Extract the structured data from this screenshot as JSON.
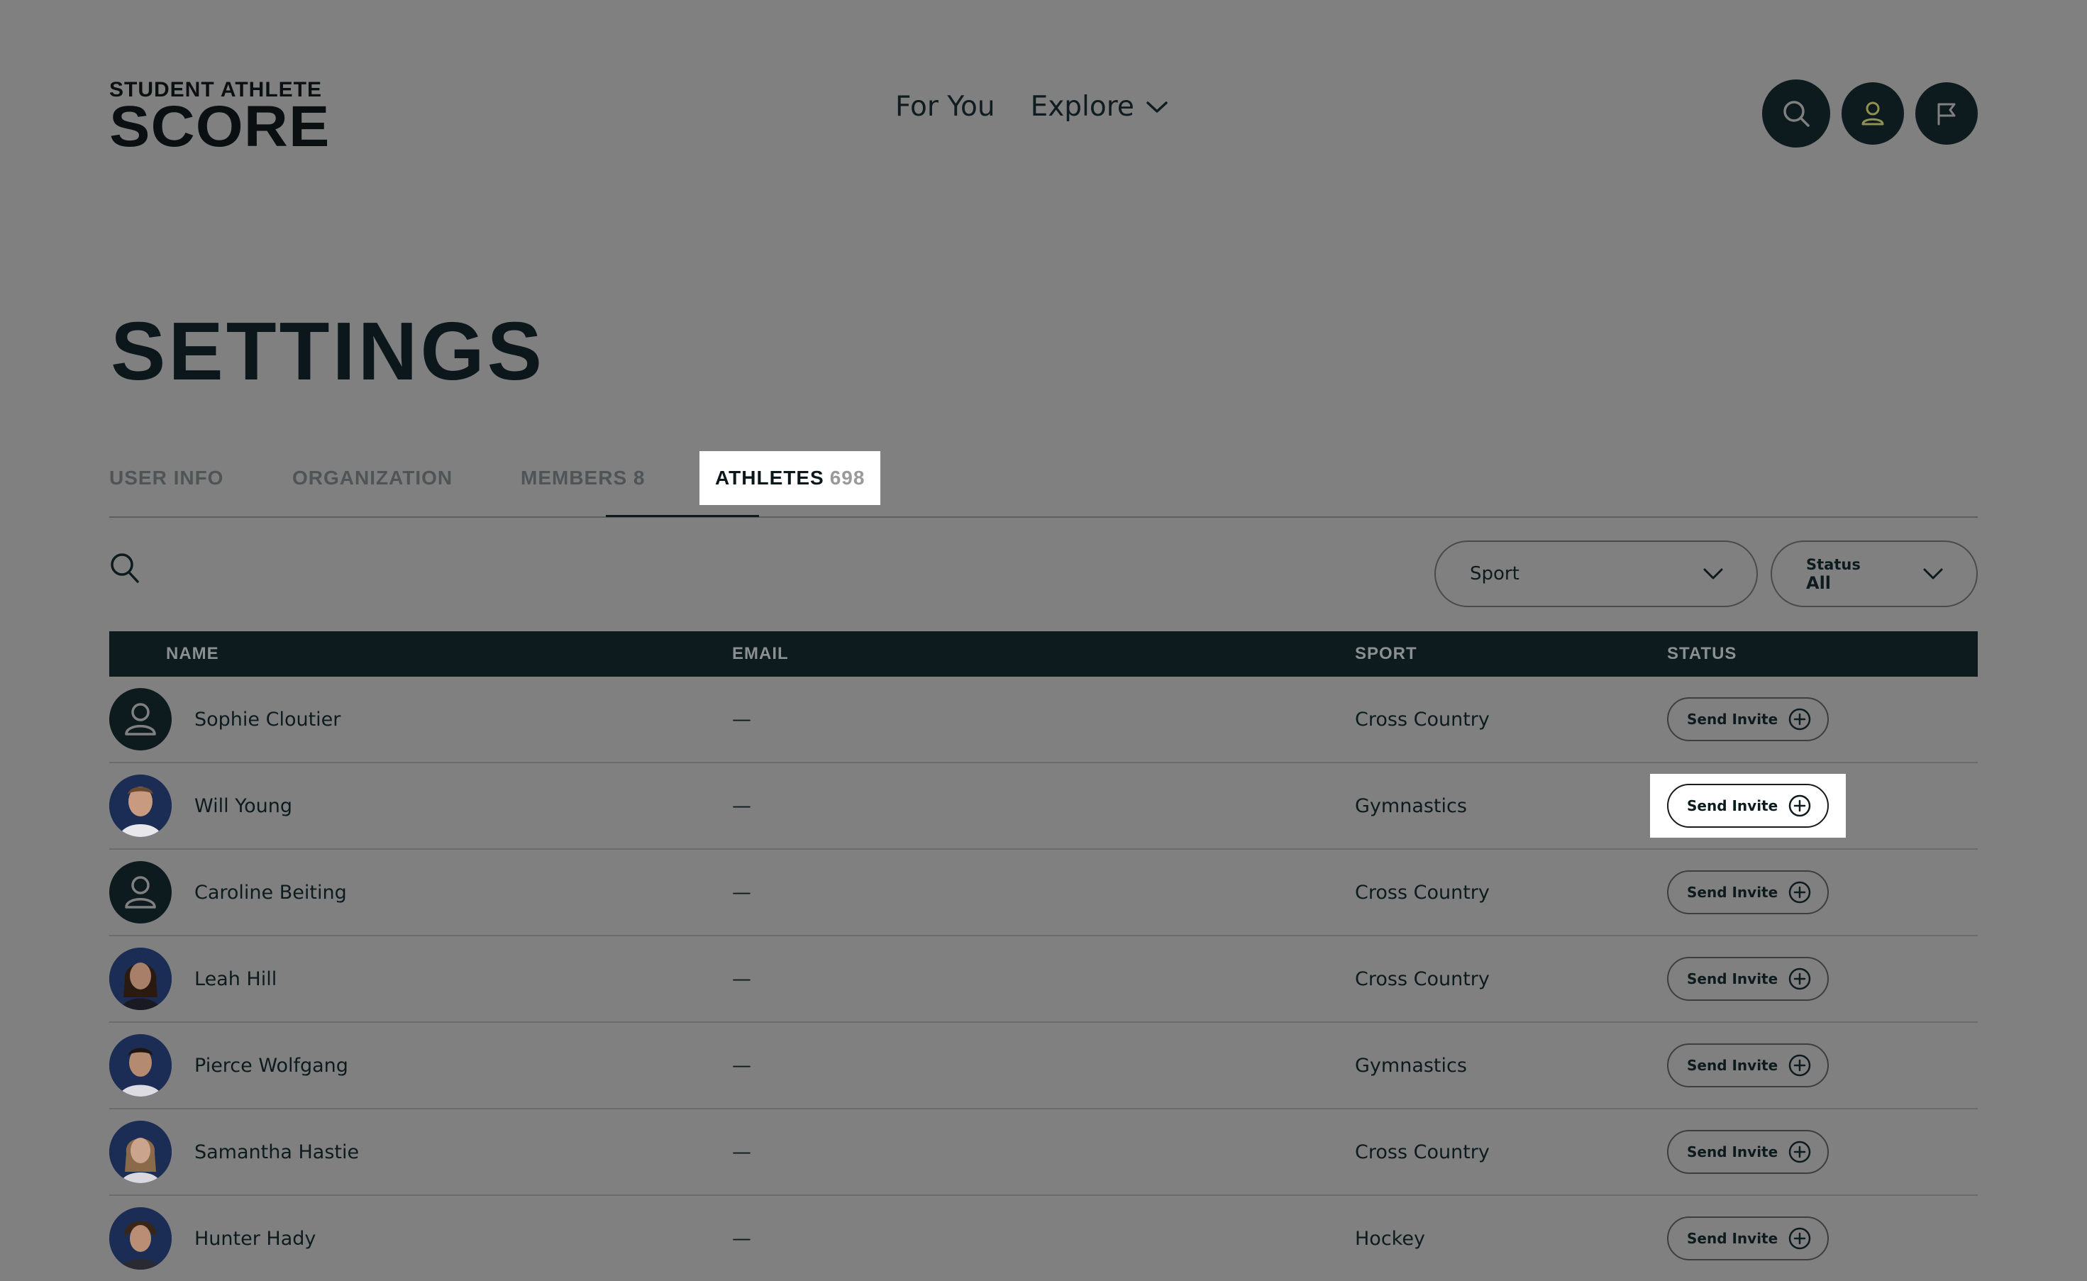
{
  "logo": {
    "line1": "STUDENT ATHLETE",
    "line2": "SCORE"
  },
  "nav": {
    "for_you": "For You",
    "explore": "Explore"
  },
  "page_title": "SETTINGS",
  "tabs": [
    {
      "label": "USER INFO"
    },
    {
      "label": "ORGANIZATION"
    },
    {
      "label": "MEMBERS 8"
    },
    {
      "label": "ATHLETES",
      "count": "698"
    }
  ],
  "filters": {
    "sport_label": "Sport",
    "status_label": "Status",
    "status_value": "All"
  },
  "table": {
    "headers": {
      "name": "NAME",
      "email": "EMAIL",
      "sport": "SPORT",
      "status": "STATUS"
    },
    "rows": [
      {
        "name": "Sophie Cloutier",
        "email": "—",
        "sport": "Cross Country",
        "action": "Send Invite"
      },
      {
        "name": "Will Young",
        "email": "—",
        "sport": "Gymnastics",
        "action": "Send Invite"
      },
      {
        "name": "Caroline Beiting",
        "email": "—",
        "sport": "Cross Country",
        "action": "Send Invite"
      },
      {
        "name": "Leah Hill",
        "email": "—",
        "sport": "Cross Country",
        "action": "Send Invite"
      },
      {
        "name": "Pierce Wolfgang",
        "email": "—",
        "sport": "Gymnastics",
        "action": "Send Invite"
      },
      {
        "name": "Samantha Hastie",
        "email": "—",
        "sport": "Cross Country",
        "action": "Send Invite"
      },
      {
        "name": "Hunter Hady",
        "email": "—",
        "sport": "Hockey",
        "action": "Send Invite"
      }
    ]
  },
  "colors": {
    "dark": "#0d1b1e",
    "overlay": "#808080",
    "accent": "#c7c96a"
  }
}
